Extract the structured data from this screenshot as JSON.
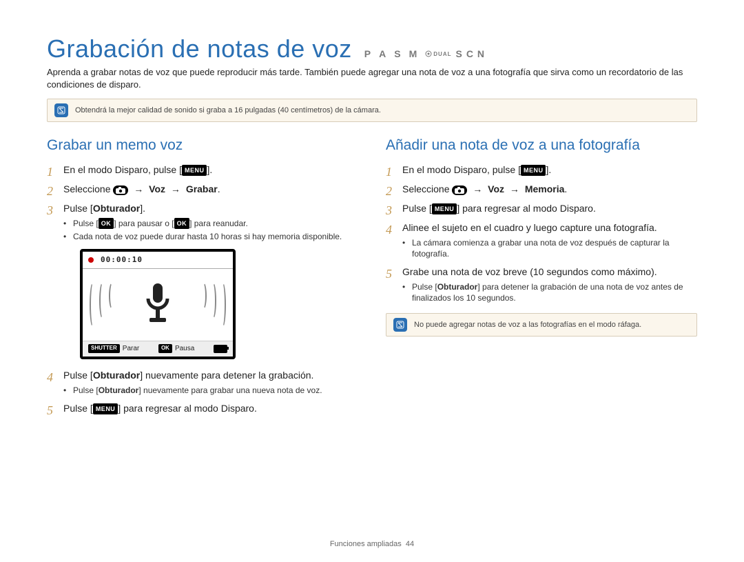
{
  "header": {
    "title": "Grabación de notas de voz",
    "modes": [
      "P",
      "A",
      "S",
      "M"
    ],
    "mode_dual": "DUAL",
    "mode_scn": "SCN",
    "intro": "Aprenda a grabar notas de voz que puede reproducir más tarde. También puede agregar una nota de voz a una fotografía que sirva como un recordatorio de las condiciones de disparo."
  },
  "info_top": "Obtendrá la mejor calidad de sonido si graba a 16 pulgadas (40 centímetros) de la cámara.",
  "buttons": {
    "menu": "MENU",
    "ok": "OK",
    "shutter": "SHUTTER"
  },
  "left": {
    "title": "Grabar un memo voz",
    "s1_a": "En el modo Disparo, pulse [",
    "s1_c": "].",
    "s2_a": "Seleccione ",
    "s2_b": " → ",
    "s2_c": "Voz",
    "s2_d": " → ",
    "s2_e": "Grabar",
    "s2_f": ".",
    "s3_a": "Pulse [",
    "s3_b": "Obturador",
    "s3_c": "].",
    "s3_bul1_a": "Pulse [",
    "s3_bul1_b": "] para pausar o [",
    "s3_bul1_c": "] para reanudar.",
    "s3_bul2": "Cada nota de voz puede durar hasta 10 horas si hay memoria disponible.",
    "lcd": {
      "timer": "00:00:10",
      "parar": "Parar",
      "pausa": "Pausa"
    },
    "s4_a": "Pulse [",
    "s4_b": "Obturador",
    "s4_c": "] nuevamente para detener la grabación.",
    "s4_bul1_a": "Pulse [",
    "s4_bul1_b": "Obturador",
    "s4_bul1_c": "] nuevamente para grabar una nueva nota de voz.",
    "s5_a": "Pulse [",
    "s5_c": "] para regresar al modo Disparo."
  },
  "right": {
    "title": "Añadir una nota de voz a una fotografía",
    "s1_a": "En el modo Disparo, pulse [",
    "s1_c": "].",
    "s2_a": "Seleccione ",
    "s2_b": " → ",
    "s2_c": "Voz",
    "s2_d": " → ",
    "s2_e": "Memoria",
    "s2_f": ".",
    "s3_a": "Pulse [",
    "s3_c": "] para regresar al modo Disparo.",
    "s4": "Alinee el sujeto en el cuadro y luego capture una fotografía.",
    "s4_bul1": "La cámara comienza a grabar una nota de voz después de capturar la fotografía.",
    "s5": "Grabe una nota de voz breve (10 segundos como máximo).",
    "s5_bul1_a": "Pulse [",
    "s5_bul1_b": "Obturador",
    "s5_bul1_c": "] para detener la grabación de una nota de voz antes de finalizados los 10 segundos.",
    "info": "No puede agregar notas de voz a las fotografías en el modo ráfaga."
  },
  "footer": {
    "section": "Funciones ampliadas",
    "page": "44"
  }
}
